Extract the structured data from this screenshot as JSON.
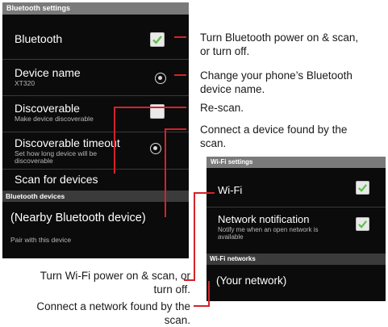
{
  "bluetooth_screen": {
    "title": "Bluetooth settings",
    "bluetooth": {
      "label": "Bluetooth"
    },
    "device_name": {
      "label": "Device name",
      "value": "XT320"
    },
    "discoverable": {
      "label": "Discoverable",
      "summary": "Make device discoverable"
    },
    "discoverable_timeout": {
      "label": "Discoverable timeout",
      "summary_line1": "Set how long device  will be",
      "summary_line2": "discoverable"
    },
    "scan": {
      "label": "Scan for devices"
    },
    "devices_header": "Bluetooth devices",
    "nearby_device": {
      "label": "(Nearby Bluetooth device)",
      "summary": "Pair with this device"
    }
  },
  "wifi_screen": {
    "title": "Wi-Fi settings",
    "wifi": {
      "label": "Wi-Fi"
    },
    "network_notification": {
      "label": "Network notification",
      "summary_line1": "Notify me when an open network is",
      "summary_line2": "available"
    },
    "networks_header": "Wi-Fi networks",
    "network": {
      "label": "(Your network)"
    }
  },
  "callouts": {
    "bt_power_1": "Turn Bluetooth power on & scan,",
    "bt_power_2": "or turn off.",
    "device_name_1": "Change your phone’s Bluetooth",
    "device_name_2": "device name.",
    "rescan": "Re-scan.",
    "connect_device_1": "Connect a device found by the",
    "connect_device_2": "scan.",
    "wifi_power_1": "Turn Wi-Fi power on & scan, or",
    "wifi_power_2": "turn off.",
    "connect_network_1": "Connect a network found by the",
    "connect_network_2": "scan."
  },
  "colors": {
    "checkbox_green": "#5fc24a",
    "leader_red": "#d3232a",
    "title_bar": "#7a7a7a"
  }
}
